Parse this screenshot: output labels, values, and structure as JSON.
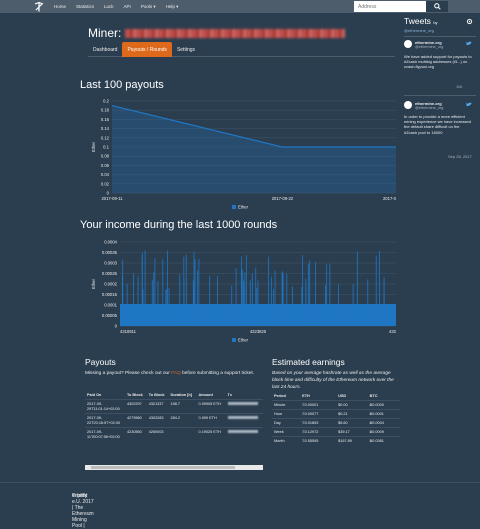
{
  "nav": {
    "links": [
      "Home",
      "Statistics",
      "Luck",
      "API",
      "Pools ▾",
      "Help ▾"
    ],
    "address_placeholder": "Address"
  },
  "header": {
    "title": "Miner:"
  },
  "tabs": [
    {
      "label": "Dashboard",
      "active": false
    },
    {
      "label": "Payouts / Rounds",
      "active": true
    },
    {
      "label": "Settings",
      "active": false
    }
  ],
  "payouts_chart": {
    "heading": "Last 100 payouts"
  },
  "income_chart": {
    "heading": "Your income during the last 1000 rounds"
  },
  "chart_data": [
    {
      "type": "area",
      "title": "Last 100 payouts",
      "ylabel": "Ether",
      "xlabel": "",
      "x": [
        "2017-09-11",
        "2017-09-22",
        "2017-0"
      ],
      "yticks": [
        "0.2",
        "0.18",
        "0.16",
        "0.14",
        "0.12",
        "0.1",
        "0.08",
        "0.06",
        "0.04",
        "0.02",
        "0"
      ],
      "ylim": [
        0,
        0.2
      ],
      "series": [
        {
          "name": "Ether",
          "points": [
            [
              0,
              0.19
            ],
            [
              0.6,
              0.1
            ],
            [
              1,
              0.1
            ]
          ]
        }
      ],
      "legend": "bottom",
      "color": "#1f77c4"
    },
    {
      "type": "bar",
      "title": "Your income during the last 1000 rounds",
      "ylabel": "Ether",
      "x_ticks": [
        "4318911",
        "4323825",
        "432"
      ],
      "yticks": [
        "0.0004",
        "0.00035",
        "0.0003",
        "0.00025",
        "0.0002",
        "0.00015",
        "0.0001",
        "0.00005",
        "0"
      ],
      "ylim": [
        0,
        0.00042
      ],
      "series": [
        {
          "name": "Ether"
        }
      ],
      "baseline_value": 0.00011,
      "legend": "bottom",
      "color": "#1f77c4"
    }
  ],
  "payouts": {
    "heading": "Payouts",
    "missing_text": "Missing a payout? Please check out our",
    "faq": "FAQ",
    "missing_text2": "before submitting a support ticket.",
    "columns": [
      "Paid On",
      "To Block",
      "To Block",
      "Duration [h]",
      "Amount",
      "Tx"
    ],
    "rows": [
      [
        "2017-09-29T11:01:14+02:00",
        "4302297",
        "4321337",
        "158.7",
        "0.09905 ETH"
      ],
      [
        "2017-09-22T20:16:57+02:00",
        "4279560",
        "4302283",
        "284.2",
        "0.099 ETH"
      ],
      [
        "2017-09-11T00:07:56+02:00",
        "4230550",
        "4260003",
        "",
        "0.19025 ETH"
      ]
    ]
  },
  "earnings": {
    "heading": "Estimated earnings",
    "description": "Based on your average hashrate as well as the average block time and difficulty of the Ethereum network over the last 24 hours.",
    "columns": [
      "Period",
      "ETH",
      "USD",
      "BTC"
    ],
    "rows": [
      [
        "Minute",
        "Ξ0.00001",
        "$0.00",
        "Ƀ0.0000"
      ],
      [
        "Hour",
        "Ξ0.00077",
        "$0.21",
        "Ƀ0.0001"
      ],
      [
        "Day",
        "Ξ0.01853",
        "$5.60",
        "Ƀ0.0004"
      ],
      [
        "Week",
        "Ξ0.12972",
        "$39.17",
        "Ƀ0.0009"
      ],
      [
        "Month",
        "Ξ0.55595",
        "$167.89",
        "Ƀ0.0381"
      ]
    ]
  },
  "tweets": {
    "heading": "Tweets",
    "by": "by",
    "handle": "@ethermine_org",
    "items": [
      {
        "name": "ethermine.org",
        "handle": "@ethermine_org",
        "text": "We have added support for payouts to #Zcash multisig addresses (t3...) on zcash.flypool.org",
        "date": "11h"
      },
      {
        "name": "ethermine.org",
        "handle": "@ethermine_org",
        "text": "In order to provide a more efficient mining experience we have increased the default share difficult on the #Zcash pool to 16000",
        "date": "Sep 28, 2017"
      }
    ]
  },
  "footer": {
    "text": "© bitfly e.U. 2017 | The Ethereum Mining Pool |",
    "imprint": "Imprint"
  }
}
